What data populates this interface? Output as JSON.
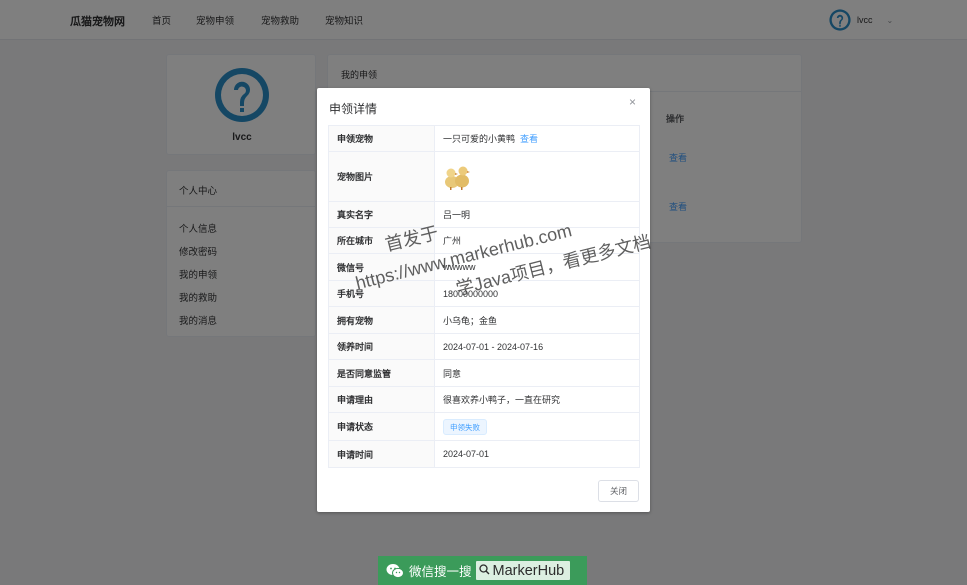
{
  "header": {
    "brand": "瓜猫宠物网",
    "nav": [
      "首页",
      "宠物申领",
      "宠物救助",
      "宠物知识"
    ],
    "username": "lvcc"
  },
  "profile": {
    "name": "lvcc"
  },
  "center": {
    "title": "个人中心",
    "links": [
      "个人信息",
      "修改密码",
      "我的申领",
      "我的救助",
      "我的消息"
    ]
  },
  "my_claims": {
    "title": "我的申领",
    "op_header": "操作",
    "view_links": [
      "查看",
      "查看"
    ]
  },
  "dialog": {
    "title": "申领详情",
    "close_icon": "×",
    "view_label": "查看",
    "rows": [
      {
        "label": "申领宠物",
        "value": "一只可爱的小黄鸭"
      },
      {
        "label": "宠物图片",
        "value": ""
      },
      {
        "label": "真实名字",
        "value": "吕一明"
      },
      {
        "label": "所在城市",
        "value": "广州"
      },
      {
        "label": "微信号",
        "value": "wwwww"
      },
      {
        "label": "手机号",
        "value": "18000000000"
      },
      {
        "label": "拥有宠物",
        "value": "小乌龟；金鱼"
      },
      {
        "label": "领养时间",
        "value": "2024-07-01 - 2024-07-16"
      },
      {
        "label": "是否同意监管",
        "value": "同意"
      },
      {
        "label": "申请理由",
        "value": "很喜欢养小鸭子，一直在研究"
      },
      {
        "label": "申请状态",
        "value": "申领失败"
      },
      {
        "label": "申请时间",
        "value": "2024-07-01"
      }
    ],
    "close_button": "关闭"
  },
  "watermark": {
    "line1": "首发于",
    "line2": "https://www.markerhub.com",
    "line3": "学Java项目，看更多文档"
  },
  "badge": {
    "text": "微信搜一搜",
    "brand": "MarkerHub"
  },
  "colors": {
    "primary": "#409eff",
    "wechat_green": "#3b9b5a"
  }
}
